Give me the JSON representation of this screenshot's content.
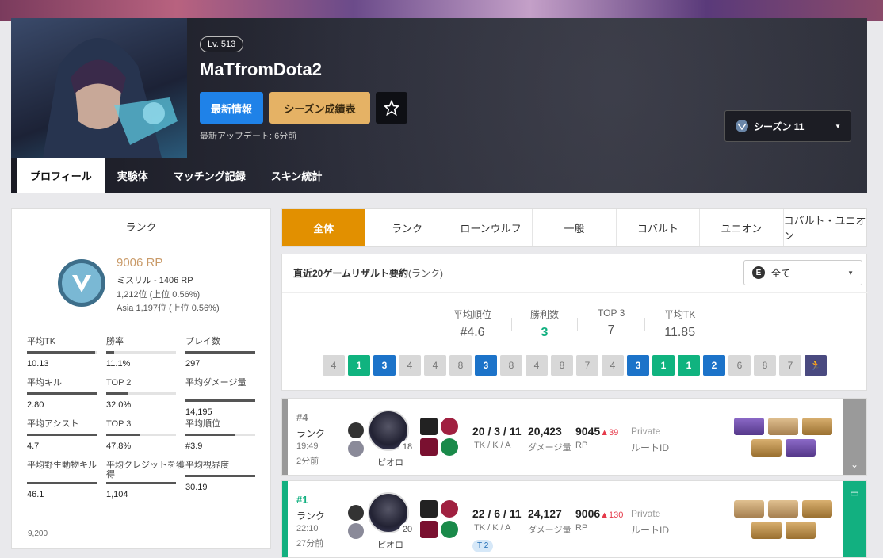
{
  "player": {
    "level": "Lv. 513",
    "name": "MaTfromDota2",
    "updated": "最新アップデート: 6分前"
  },
  "buttons": {
    "latest": "最新情報",
    "season": "シーズン成績表"
  },
  "season_select": {
    "value": "シーズン 11"
  },
  "tabs": [
    "プロフィール",
    "実験体",
    "マッチング記録",
    "スキン統計"
  ],
  "rank": {
    "title": "ランク",
    "rp": "9006 RP",
    "tier": "ミスリル - 1406 RP",
    "pos": "1,212位 (上位 0.56%)",
    "asia": "Asia 1,197位 (上位 0.56%)"
  },
  "stats": [
    {
      "label": "平均TK",
      "value": "10.13",
      "fill": 0.98
    },
    {
      "label": "勝率",
      "value": "11.1%",
      "fill": 0.11
    },
    {
      "label": "プレイ数",
      "value": "297",
      "fill": 1.0
    },
    {
      "label": "平均キル",
      "value": "2.80",
      "fill": 1.0
    },
    {
      "label": "TOP 2",
      "value": "32.0%",
      "fill": 0.32
    },
    {
      "label": "平均ダメージ量",
      "value": "14,195",
      "fill": 1.0
    },
    {
      "label": "平均アシスト",
      "value": "4.7",
      "fill": 1.0
    },
    {
      "label": "TOP 3",
      "value": "47.8%",
      "fill": 0.48
    },
    {
      "label": "平均順位",
      "value": "#3.9",
      "fill": 0.7
    },
    {
      "label": "平均野生動物キル",
      "value": "46.1",
      "fill": 1.0
    },
    {
      "label": "平均クレジットを獲得",
      "value": "1,104",
      "fill": 1.0
    },
    {
      "label": "平均視界度",
      "value": "30.19",
      "fill": 1.0
    }
  ],
  "chart_tick": "9,200",
  "filters": [
    "全体",
    "ランク",
    "ローンウルフ",
    "一般",
    "コバルト",
    "ユニオン",
    "コバルト・ユニオン"
  ],
  "summary": {
    "title": "直近20ゲームリザルト要約",
    "title_sub": "(ランク)",
    "select": "全て",
    "select_icon": "E",
    "avg_place_label": "平均順位",
    "avg_place": "#4.6",
    "wins_label": "勝利数",
    "wins": "3",
    "top3_label": "TOP 3",
    "top3": "7",
    "avg_tk_label": "平均TK",
    "avg_tk": "11.85",
    "places": [
      "4",
      "1",
      "3",
      "4",
      "4",
      "8",
      "3",
      "8",
      "4",
      "8",
      "7",
      "4",
      "3",
      "1",
      "1",
      "2",
      "6",
      "8",
      "7",
      ""
    ]
  },
  "matches": [
    {
      "place": "#4",
      "mode": "ランク",
      "time": "19:49",
      "ago": "2分前",
      "char": "ピオロ",
      "char_lvl": "18",
      "kda": "20 / 3 / 11",
      "kda_label": "TK / K / A",
      "dmg": "20,423",
      "dmg_label": "ダメージ量",
      "rp": "9045",
      "rp_delta": "▲39",
      "rp_label": "RP",
      "privacy": "Private",
      "route": "ルートID"
    },
    {
      "place": "#1",
      "mode": "ランク",
      "time": "22:10",
      "ago": "27分前",
      "char": "ピオロ",
      "char_lvl": "20",
      "kda": "22 / 6 / 11",
      "kda_label": "TK / K / A",
      "dmg": "24,127",
      "dmg_label": "ダメージ量",
      "rp": "9006",
      "rp_delta": "▲130",
      "rp_label": "RP",
      "privacy": "Private",
      "route": "ルートID",
      "tier": "T 2"
    }
  ],
  "colors": {
    "accent_orange": "#e29000",
    "win_green": "#12b080",
    "blue": "#1c73c9",
    "rp_gold": "#c99a68"
  }
}
